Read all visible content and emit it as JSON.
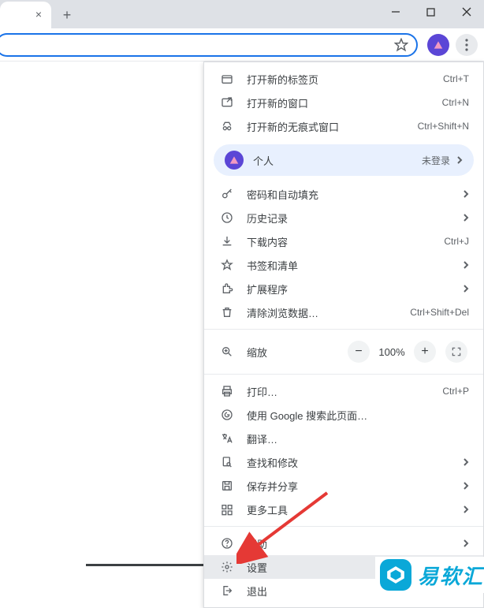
{
  "window": {
    "min": "–",
    "max": "☐",
    "close": "×"
  },
  "menu": {
    "newTab": {
      "label": "打开新的标签页",
      "shortcut": "Ctrl+T"
    },
    "newWindow": {
      "label": "打开新的窗口",
      "shortcut": "Ctrl+N"
    },
    "newIncognito": {
      "label": "打开新的无痕式窗口",
      "shortcut": "Ctrl+Shift+N"
    },
    "profile": {
      "label": "个人",
      "status": "未登录"
    },
    "passwords": {
      "label": "密码和自动填充"
    },
    "history": {
      "label": "历史记录"
    },
    "downloads": {
      "label": "下载内容",
      "shortcut": "Ctrl+J"
    },
    "bookmarks": {
      "label": "书签和清单"
    },
    "extensions": {
      "label": "扩展程序"
    },
    "clearData": {
      "label": "清除浏览数据…",
      "shortcut": "Ctrl+Shift+Del"
    },
    "zoom": {
      "label": "缩放",
      "value": "100%"
    },
    "print": {
      "label": "打印…",
      "shortcut": "Ctrl+P"
    },
    "googleSearch": {
      "label": "使用 Google 搜索此页面…"
    },
    "translate": {
      "label": "翻译…"
    },
    "find": {
      "label": "查找和修改"
    },
    "saveShare": {
      "label": "保存并分享"
    },
    "moreTools": {
      "label": "更多工具"
    },
    "help": {
      "label": "帮助"
    },
    "settings": {
      "label": "设置"
    },
    "exit": {
      "label": "退出"
    }
  },
  "watermark": {
    "text": "易软汇"
  }
}
